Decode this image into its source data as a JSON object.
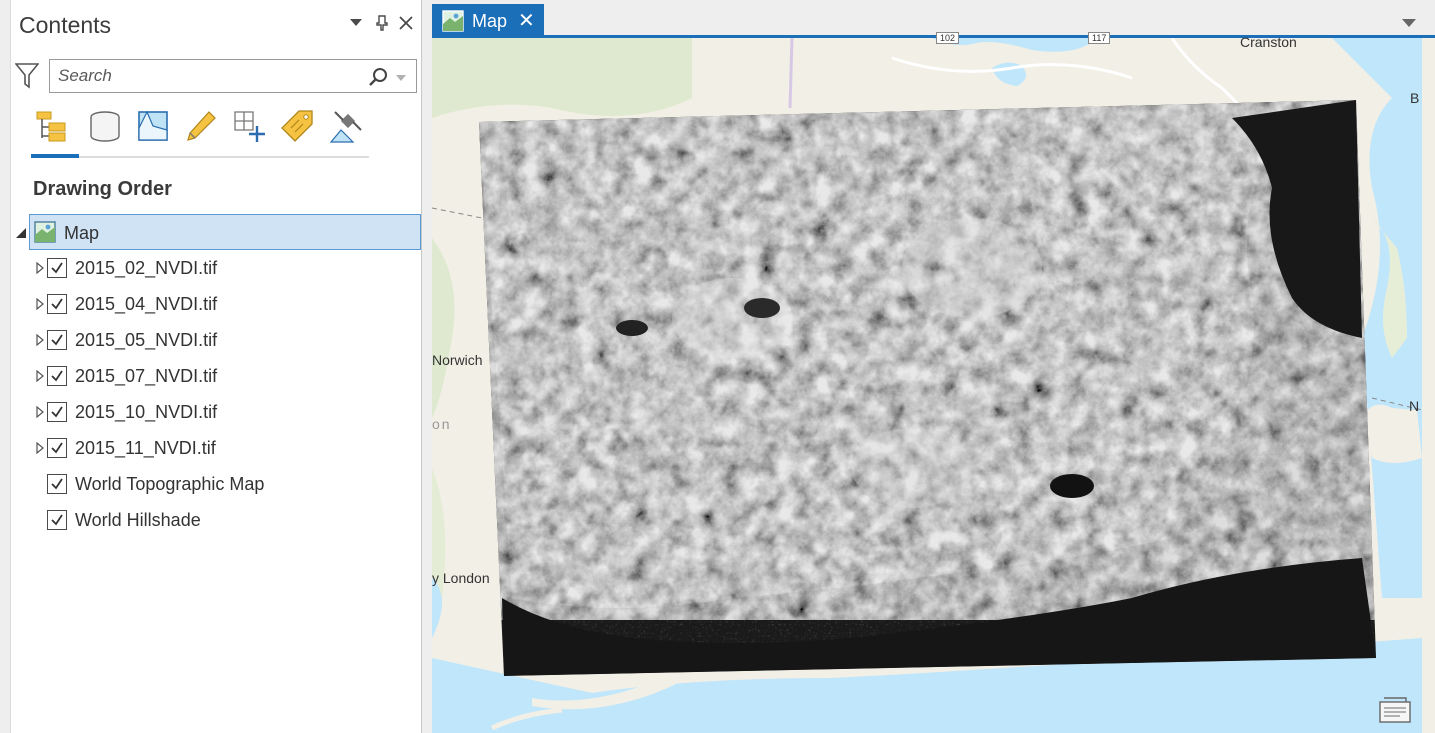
{
  "contents": {
    "title": "Contents",
    "search": {
      "placeholder": "Search"
    },
    "section_title": "Drawing Order",
    "toolbar": [
      {
        "name": "list-by-drawing-order",
        "icon": "drawing-order-icon"
      },
      {
        "name": "list-by-data-source",
        "icon": "database-icon"
      },
      {
        "name": "list-by-selection",
        "icon": "selection-icon"
      },
      {
        "name": "list-by-editing",
        "icon": "pencil-icon"
      },
      {
        "name": "list-by-snapping",
        "icon": "snapping-icon"
      },
      {
        "name": "list-by-labeling",
        "icon": "label-tag-icon"
      },
      {
        "name": "list-by-perspective-imagery",
        "icon": "satellite-icon"
      }
    ],
    "map_item": {
      "label": "Map"
    },
    "layers": [
      {
        "label": "2015_02_NVDI.tif",
        "checked": true,
        "expandable": true
      },
      {
        "label": "2015_04_NVDI.tif",
        "checked": true,
        "expandable": true
      },
      {
        "label": "2015_05_NVDI.tif",
        "checked": true,
        "expandable": true
      },
      {
        "label": "2015_07_NVDI.tif",
        "checked": true,
        "expandable": true
      },
      {
        "label": "2015_10_NVDI.tif",
        "checked": true,
        "expandable": true
      },
      {
        "label": "2015_11_NVDI.tif",
        "checked": true,
        "expandable": true
      },
      {
        "label": "World Topographic Map",
        "checked": true,
        "expandable": false
      },
      {
        "label": "World Hillshade",
        "checked": true,
        "expandable": false
      }
    ]
  },
  "map_view": {
    "tab_label": "Map",
    "places": {
      "cranston": "Cranston",
      "norwich": "Norwich",
      "london": "y London",
      "partial_on": "on",
      "partial_n": "N",
      "partial_b": "B"
    },
    "shields": {
      "s1": "102",
      "s2": "117"
    }
  },
  "colors": {
    "accent": "#1b6fb8",
    "selection": "#cfe3f5",
    "water": "#bfe6fb"
  }
}
